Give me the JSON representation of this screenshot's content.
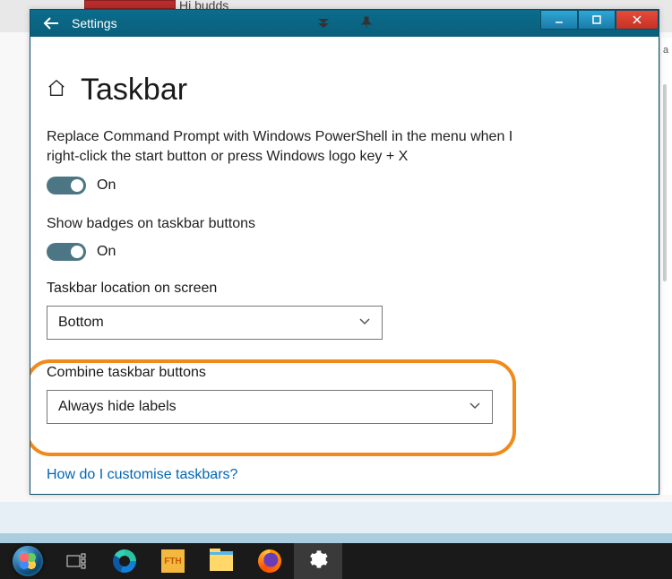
{
  "background": {
    "chat_snippet": "Hi budds"
  },
  "window": {
    "title": "Settings",
    "page_title": "Taskbar",
    "settings": {
      "powershell": {
        "label": "Replace Command Prompt with Windows PowerShell in the menu when I right-click the start button or press Windows logo key + X",
        "state": "On"
      },
      "badges": {
        "label": "Show badges on taskbar buttons",
        "state": "On"
      },
      "location": {
        "label": "Taskbar location on screen",
        "value": "Bottom"
      },
      "combine": {
        "label": "Combine taskbar buttons",
        "value": "Always hide labels"
      }
    },
    "help_link": "How do I customise taskbars?"
  },
  "taskbar": {
    "fth_label": "FTH"
  }
}
